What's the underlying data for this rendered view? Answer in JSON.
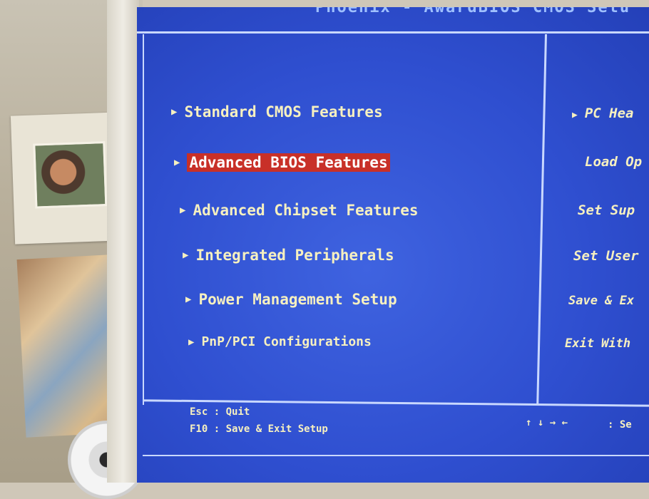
{
  "bios": {
    "title": "Phoenix - AwardBIOS CMOS Setu",
    "left_menu": [
      {
        "label": "Standard CMOS Features",
        "selected": false
      },
      {
        "label": "Advanced BIOS Features",
        "selected": true
      },
      {
        "label": "Advanced Chipset Features",
        "selected": false
      },
      {
        "label": "Integrated Peripherals",
        "selected": false
      },
      {
        "label": "Power Management Setup",
        "selected": false
      },
      {
        "label": "PnP/PCI Configurations",
        "selected": false
      }
    ],
    "right_menu": [
      {
        "label": "PC Hea",
        "has_arrow": true
      },
      {
        "label": "Load Op",
        "has_arrow": false
      },
      {
        "label": "Set Sup",
        "has_arrow": false
      },
      {
        "label": "Set User",
        "has_arrow": false
      },
      {
        "label": "Save & Ex",
        "has_arrow": false
      },
      {
        "label": "Exit With",
        "has_arrow": false
      }
    ],
    "help": {
      "esc": "Esc : Quit",
      "f10": "F10 : Save & Exit Setup",
      "arrows": "↑ ↓ → ←",
      "arrows_desc": ": Se"
    },
    "colors": {
      "background": "#2f4fd0",
      "text": "#f6f0c0",
      "highlight": "#c83028"
    }
  }
}
